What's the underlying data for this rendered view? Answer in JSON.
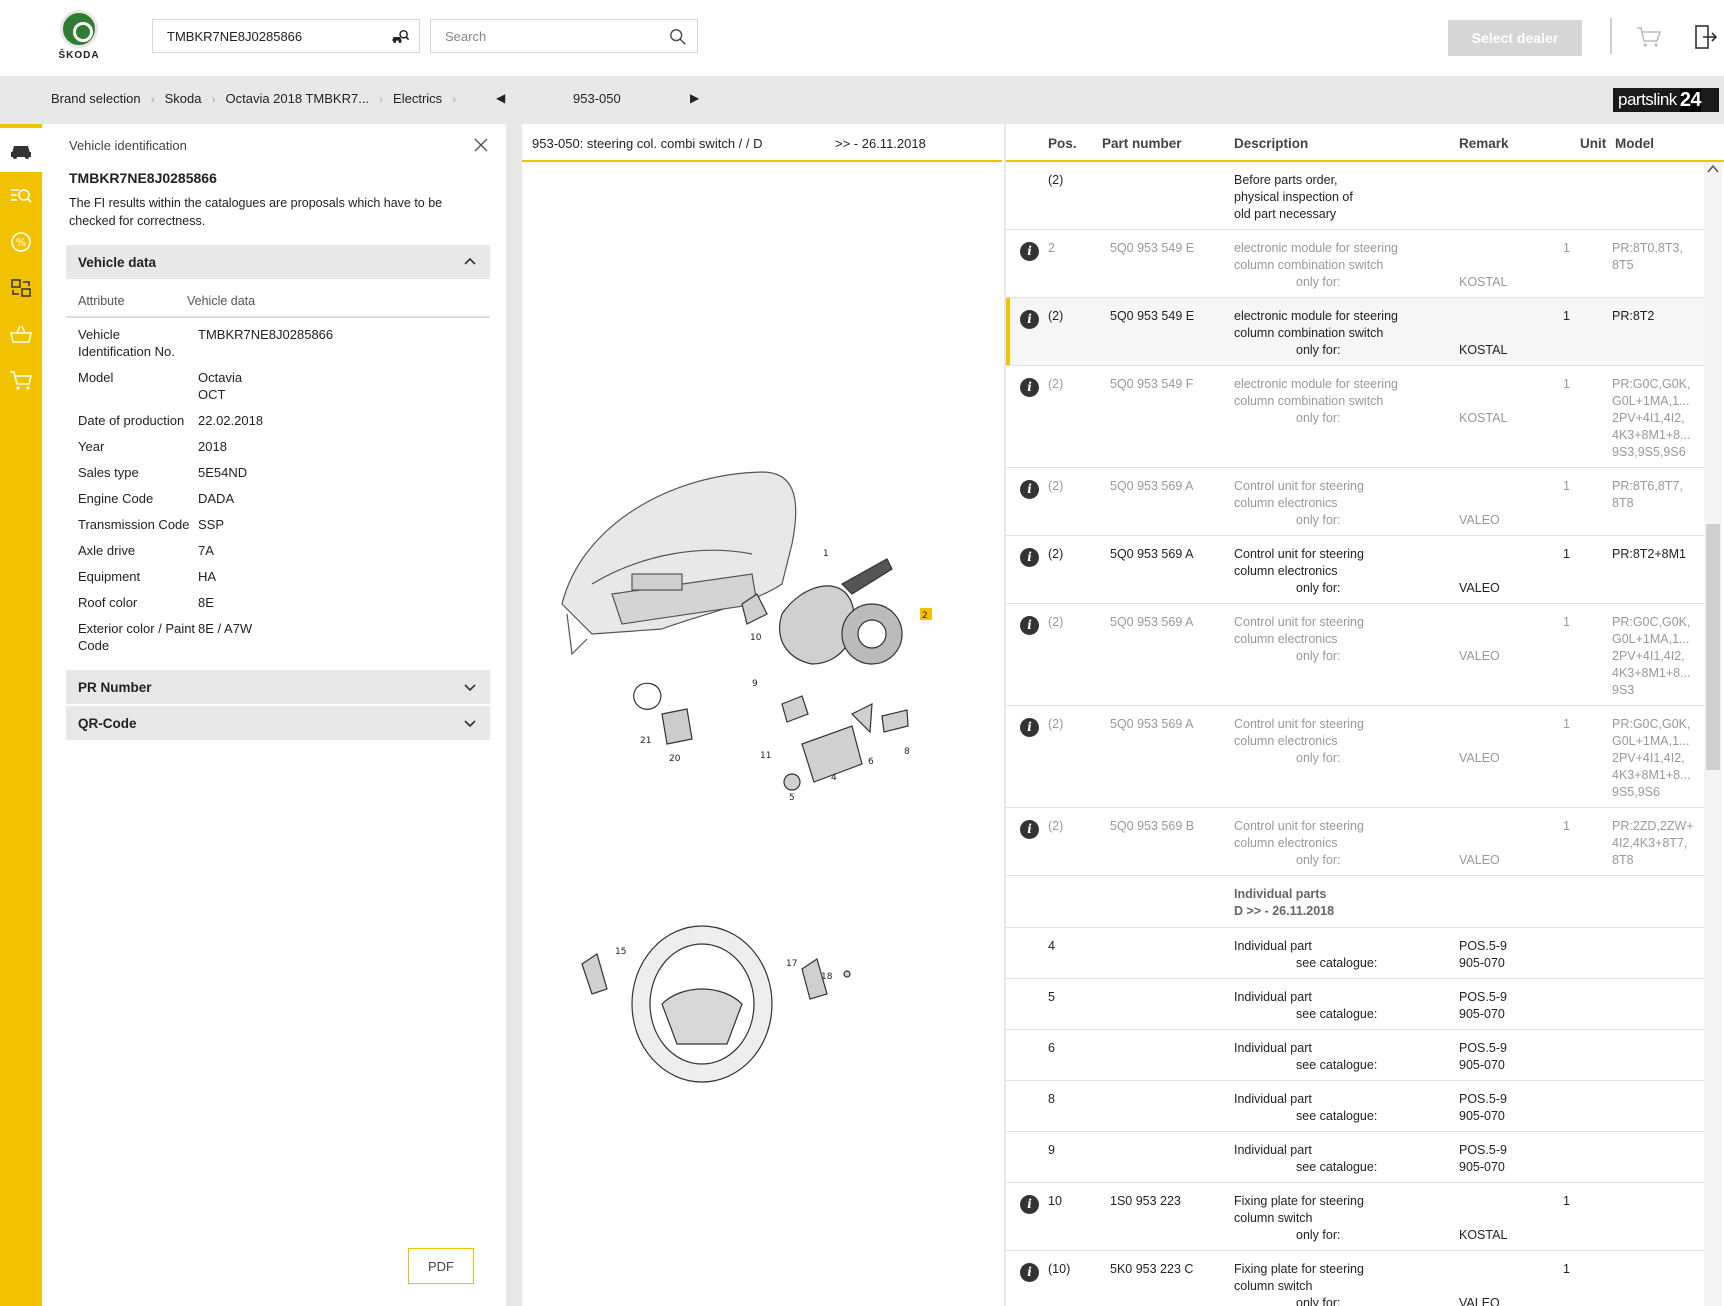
{
  "header": {
    "brand": "ŠKODA",
    "vin_value": "TMBKR7NE8J0285866",
    "search_placeholder": "Search",
    "dealer_button": "Select dealer"
  },
  "breadcrumb": {
    "items": [
      "Brand selection",
      "Skoda",
      "Octavia 2018 TMBKR7...",
      "Electrics"
    ],
    "page": "953-050",
    "partslink_text": "partslink",
    "partslink_num": "24"
  },
  "vehicle_panel": {
    "title": "Vehicle identification",
    "vin": "TMBKR7NE8J0285866",
    "note": "The FI results within the catalogues are proposals which have to be checked for correctness.",
    "vehicle_data_label": "Vehicle data",
    "col_attribute": "Attribute",
    "col_value": "Vehicle data",
    "rows": [
      {
        "k": "Vehicle Identification No.",
        "v": "TMBKR7NE8J0285866"
      },
      {
        "k": "Model",
        "v": "Octavia\nOCT"
      },
      {
        "k": "Date of production",
        "v": "22.02.2018"
      },
      {
        "k": "Year",
        "v": "2018"
      },
      {
        "k": "Sales type",
        "v": "5E54ND"
      },
      {
        "k": "Engine Code",
        "v": "DADA"
      },
      {
        "k": "Transmission Code",
        "v": "SSP"
      },
      {
        "k": "Axle drive",
        "v": "7A"
      },
      {
        "k": "Equipment",
        "v": "HA"
      },
      {
        "k": "Roof color",
        "v": "8E"
      },
      {
        "k": "Exterior color / Paint Code",
        "v": "8E / A7W"
      }
    ],
    "pr_number_label": "PR Number",
    "qr_code_label": "QR-Code",
    "pdf_label": "PDF"
  },
  "diagram_panel": {
    "title": "953-050: steering col. combi switch /  / D",
    "date": ">> - 26.11.2018",
    "labels": [
      "1",
      "2",
      "4",
      "5",
      "6",
      "8",
      "9",
      "10",
      "11",
      "15",
      "17",
      "18",
      "20",
      "21"
    ]
  },
  "table": {
    "headers": {
      "pos": "Pos.",
      "part": "Part number",
      "desc": "Description",
      "remark": "Remark",
      "unit": "Unit",
      "model": "Model"
    },
    "rows": [
      {
        "info": false,
        "dim": false,
        "pos": "(2)",
        "pn": "",
        "desc": "Before parts order,\nphysical inspection of\nold part necessary",
        "only": "",
        "rem": "",
        "unit": "",
        "model": ""
      },
      {
        "info": true,
        "dim": true,
        "pos": "2",
        "pn": "5Q0 953 549 E",
        "desc": "electronic module for steering\ncolumn combination switch",
        "only": "only for:",
        "rem": "KOSTAL",
        "unit": "1",
        "model": "PR:8T0,8T3,\n8T5"
      },
      {
        "info": true,
        "dim": false,
        "sel": true,
        "pos": "(2)",
        "pn": "5Q0 953 549 E",
        "desc": "electronic module for steering\ncolumn combination switch",
        "only": "only for:",
        "rem": "KOSTAL",
        "unit": "1",
        "model": "PR:8T2"
      },
      {
        "info": true,
        "dim": true,
        "pos": "(2)",
        "pn": "5Q0 953 549 F",
        "desc": "electronic module for steering\ncolumn combination switch",
        "only": "only for:",
        "rem": "KOSTAL",
        "unit": "1",
        "model": "PR:G0C,G0K,\nG0L+1MA,1...\n2PV+4I1,4I2,\n4K3+8M1+8...\n9S3,9S5,9S6"
      },
      {
        "info": true,
        "dim": true,
        "pos": "(2)",
        "pn": "5Q0 953 569 A",
        "desc": "Control unit for steering\ncolumn electronics",
        "only": "only for:",
        "rem": "VALEO",
        "unit": "1",
        "model": "PR:8T6,8T7,\n8T8"
      },
      {
        "info": true,
        "dim": false,
        "pos": "(2)",
        "pn": "5Q0 953 569 A",
        "desc": "Control unit for steering\ncolumn electronics",
        "only": "only for:",
        "rem": "VALEO",
        "unit": "1",
        "model": "PR:8T2+8M1"
      },
      {
        "info": true,
        "dim": true,
        "pos": "(2)",
        "pn": "5Q0 953 569 A",
        "desc": "Control unit for steering\ncolumn electronics",
        "only": "only for:",
        "rem": "VALEO",
        "unit": "1",
        "model": "PR:G0C,G0K,\nG0L+1MA,1...\n2PV+4I1,4I2,\n4K3+8M1+8...\n9S3"
      },
      {
        "info": true,
        "dim": true,
        "pos": "(2)",
        "pn": "5Q0 953 569 A",
        "desc": "Control unit for steering\ncolumn electronics",
        "only": "only for:",
        "rem": "VALEO",
        "unit": "1",
        "model": "PR:G0C,G0K,\nG0L+1MA,1...\n2PV+4I1,4I2,\n4K3+8M1+8...\n9S5,9S6"
      },
      {
        "info": true,
        "dim": true,
        "pos": "(2)",
        "pn": "5Q0 953 569 B",
        "desc": "Control unit for steering\ncolumn electronics",
        "only": "only for:",
        "rem": "VALEO",
        "unit": "1",
        "model": "PR:2ZD,2ZW+\n4I2,4K3+8T7,\n8T8"
      },
      {
        "info": false,
        "dim": false,
        "section": true,
        "pos": "",
        "pn": "",
        "desc": "Individual parts\nD           >> - 26.11.2018",
        "only": "",
        "rem": "",
        "unit": "",
        "model": ""
      },
      {
        "info": false,
        "dim": false,
        "pos": "4",
        "pn": "",
        "desc": "Individual part",
        "only": "see catalogue:",
        "rem": "POS.5-9\n905-070",
        "unit": "",
        "model": ""
      },
      {
        "info": false,
        "dim": false,
        "pos": "5",
        "pn": "",
        "desc": "Individual part",
        "only": "see catalogue:",
        "rem": "POS.5-9\n905-070",
        "unit": "",
        "model": ""
      },
      {
        "info": false,
        "dim": false,
        "pos": "6",
        "pn": "",
        "desc": "Individual part",
        "only": "see catalogue:",
        "rem": "POS.5-9\n905-070",
        "unit": "",
        "model": ""
      },
      {
        "info": false,
        "dim": false,
        "pos": "8",
        "pn": "",
        "desc": "Individual part",
        "only": "see catalogue:",
        "rem": "POS.5-9\n905-070",
        "unit": "",
        "model": ""
      },
      {
        "info": false,
        "dim": false,
        "pos": "9",
        "pn": "",
        "desc": "Individual part",
        "only": "see catalogue:",
        "rem": "POS.5-9\n905-070",
        "unit": "",
        "model": ""
      },
      {
        "info": true,
        "dim": false,
        "pos": "10",
        "pn": "1S0 953 223",
        "desc": "Fixing plate for steering\ncolumn switch",
        "only": "only for:",
        "rem": "KOSTAL",
        "unit": "1",
        "model": ""
      },
      {
        "info": true,
        "dim": false,
        "pos": "(10)",
        "pn": "5K0 953 223 C",
        "desc": "Fixing plate for steering\ncolumn switch",
        "only": "only for:",
        "rem": "VALEO",
        "unit": "1",
        "model": ""
      }
    ]
  },
  "colors": {
    "accent": "#f2c200",
    "brand_green": "#2e7d32"
  }
}
